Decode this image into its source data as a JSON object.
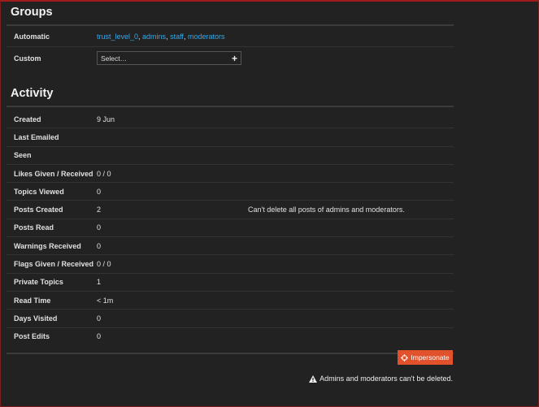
{
  "groups": {
    "title": "Groups",
    "automatic_label": "Automatic",
    "automatic_groups": [
      "trust_level_0",
      "admins",
      "staff",
      "moderators"
    ],
    "custom_label": "Custom",
    "custom_select_placeholder": "Select…"
  },
  "activity": {
    "title": "Activity",
    "rows": [
      {
        "label": "Created",
        "value": "9 Jun"
      },
      {
        "label": "Last Emailed",
        "value": ""
      },
      {
        "label": "Seen",
        "value": ""
      },
      {
        "label": "Likes Given / Received",
        "value": "0 / 0"
      },
      {
        "label": "Topics Viewed",
        "value": "0"
      },
      {
        "label": "Posts Created",
        "value": "2",
        "note": "Can't delete all posts of admins and moderators."
      },
      {
        "label": "Posts Read",
        "value": "0"
      },
      {
        "label": "Warnings Received",
        "value": "0"
      },
      {
        "label": "Flags Given / Received",
        "value": "0 / 0"
      },
      {
        "label": "Private Topics",
        "value": "1"
      },
      {
        "label": "Read Time",
        "value": "< 1m"
      },
      {
        "label": "Days Visited",
        "value": "0"
      },
      {
        "label": "Post Edits",
        "value": "0"
      }
    ]
  },
  "actions": {
    "impersonate_label": "Impersonate",
    "delete_warning": "Admins and moderators can't be deleted."
  },
  "colors": {
    "background": "#222222",
    "link": "#36a8e6",
    "impersonate_button": "#e0512c",
    "border": "#a01c1c"
  }
}
